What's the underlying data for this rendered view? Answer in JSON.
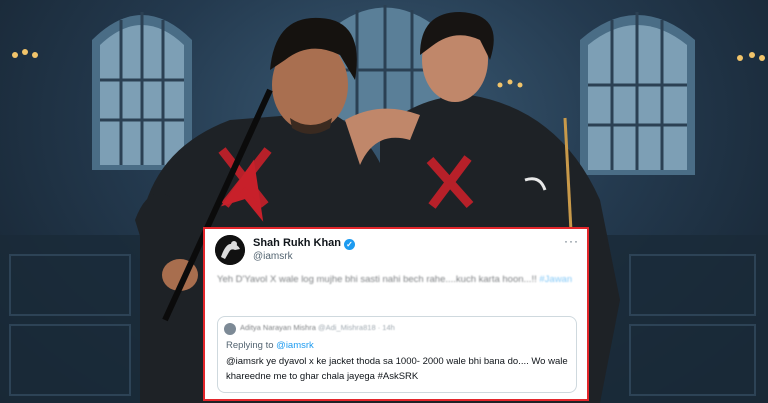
{
  "tweet": {
    "author_name": "Shah Rukh Khan",
    "author_handle": "@iamsrk",
    "text": "Yeh D'Yavol X wale log mujhe bhi sasti nahi bech rahe....kuch karta hoon...!!",
    "hashtag": "#Jawan",
    "more_glyph": "···",
    "verified_glyph": "✓"
  },
  "quote": {
    "author_name": "Aditya Narayan Mishra",
    "author_handle": "@Adi_Mishra818 · 14h",
    "replying_prefix": "Replying to",
    "replying_handle": "@iamsrk",
    "text": "@iamsrk ye dyavol x  ke jacket thoda sa 1000- 2000 wale bhi bana do.... Wo wale khareedne me to ghar chala jayega #AskSRK"
  },
  "colors": {
    "card_border": "#e3262b",
    "verified": "#1d9bf0",
    "link": "#1d9bf0",
    "hoodie": "#1e2226",
    "accent_x": "#c8202a"
  }
}
